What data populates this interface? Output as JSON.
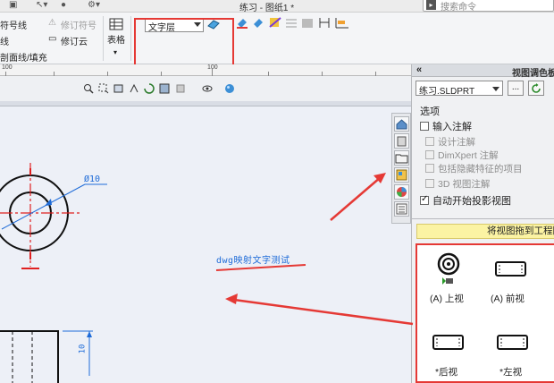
{
  "window": {
    "title": "练习 - 图纸1 *",
    "search_placeholder": "搜索命令"
  },
  "ribbon": {
    "left_items": [
      "符号线",
      "线",
      "剖面线/填充"
    ],
    "revision_symbol": "修订符号",
    "revision_cloud": "修订云",
    "table_label": "表格",
    "layer_value": "文字层"
  },
  "ruler": {
    "labels": [
      "100",
      "100"
    ]
  },
  "taskpane": {
    "collapse": "«",
    "title": "视图调色板",
    "file_value": "练习.SLDPRT",
    "browse_button": "...",
    "options_title": "选项",
    "options": [
      {
        "label": "输入注解",
        "checked": false,
        "enabled": true
      },
      {
        "label": "设计注解",
        "checked": false,
        "enabled": false
      },
      {
        "label": "DimXpert 注解",
        "checked": false,
        "enabled": false
      },
      {
        "label": "包括隐藏特征的项目",
        "checked": false,
        "enabled": false
      },
      {
        "label": "3D 视图注解",
        "checked": false,
        "enabled": false
      },
      {
        "label": "自动开始投影视图",
        "checked": true,
        "enabled": true
      }
    ],
    "drag_hint": "将视图拖到工程图",
    "views": [
      {
        "label": "(A) 上视"
      },
      {
        "label": "(A) 前视"
      },
      {
        "label": "*后视"
      },
      {
        "label": "*左视"
      }
    ]
  },
  "drawing": {
    "diameter_dim": "Ø10",
    "annotation_text": "dwg映射文字测试",
    "vertical_dim": "10"
  },
  "colors": {
    "highlight": "#e53935",
    "dimension": "#1e6bd8",
    "centerline": "#e02020",
    "drag_bar": "#fbf3a3"
  }
}
